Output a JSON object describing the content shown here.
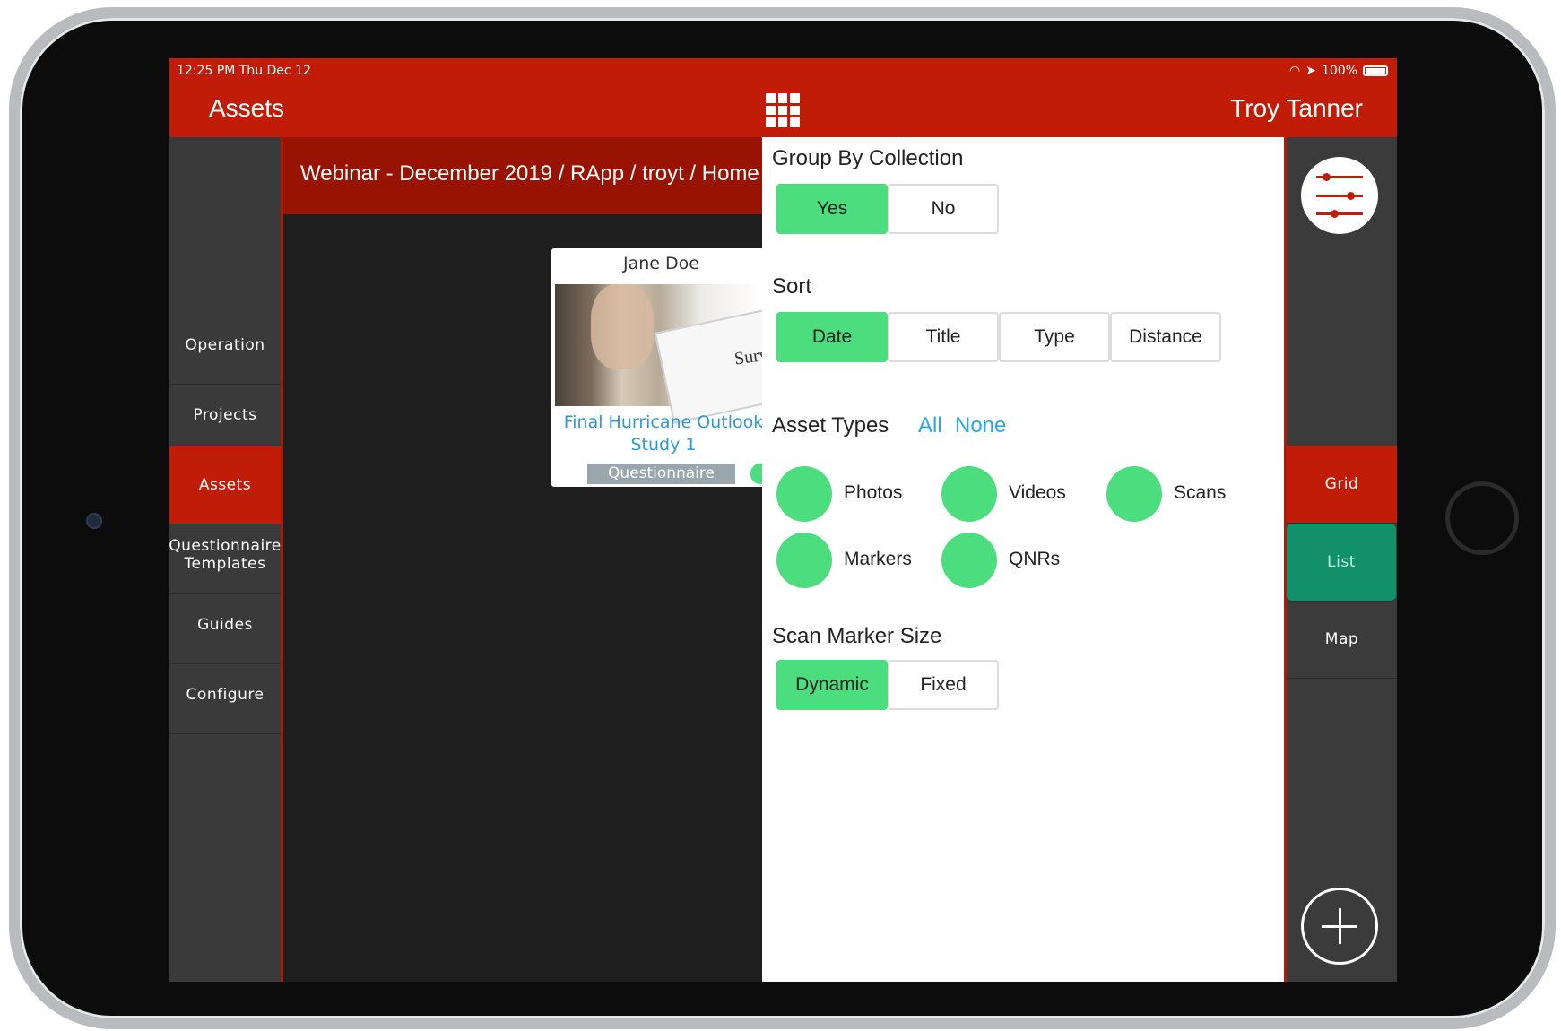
{
  "status": {
    "time": "12:25 PM   Thu Dec 12",
    "battery": "100%"
  },
  "header": {
    "title": "Assets",
    "user": "Troy Tanner"
  },
  "leftnav": {
    "items": [
      {
        "label": "Operation"
      },
      {
        "label": "Projects"
      },
      {
        "label": "Assets"
      },
      {
        "label": "Questionnaire Templates"
      },
      {
        "label": "Guides"
      },
      {
        "label": "Configure"
      }
    ]
  },
  "breadcrumb": "Webinar - December 2019 / RApp / troyt / Home",
  "card": {
    "user": "Jane Doe",
    "title": "Final Hurricane Outlook Study 1",
    "tag": "Questionnaire",
    "image_text": "Surv"
  },
  "panel": {
    "group_by": {
      "title": "Group By Collection",
      "options": [
        "Yes",
        "No"
      ],
      "selected": "Yes"
    },
    "sort": {
      "title": "Sort",
      "options": [
        "Date",
        "Title",
        "Type",
        "Distance"
      ],
      "selected": "Date"
    },
    "asset_types": {
      "title": "Asset Types",
      "all_label": "All",
      "none_label": "None",
      "types": [
        "Photos",
        "Videos",
        "Scans",
        "Markers",
        "QNRs"
      ]
    },
    "scan_marker_size": {
      "title": "Scan Marker Size",
      "options": [
        "Dynamic",
        "Fixed"
      ],
      "selected": "Dynamic"
    }
  },
  "rightnav": {
    "views": [
      "Grid",
      "List",
      "Map"
    ]
  },
  "colors": {
    "brand_red": "#c11c07",
    "toggle_green": "#4bdd7e",
    "link_blue": "#27a8e8",
    "list_active": "#11906a"
  }
}
